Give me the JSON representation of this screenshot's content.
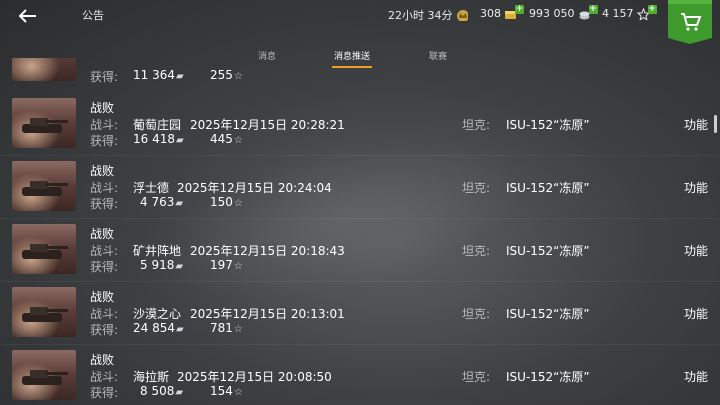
{
  "header": {
    "title": "公告",
    "timer": "22小时 34分",
    "gold": "308",
    "credits": "993 050",
    "free_xp": "4 157"
  },
  "tabs": [
    {
      "label": "消息",
      "active": false
    },
    {
      "label": "消息推送",
      "active": true
    },
    {
      "label": "联赛",
      "active": false
    }
  ],
  "partial_row": {
    "credits": "11 364",
    "xp": "255"
  },
  "labels": {
    "battle": "战斗:",
    "earned": "获得:",
    "tank": "坦克:",
    "function": "功能"
  },
  "entries": [
    {
      "result": "战败",
      "map": "葡萄庄园",
      "datetime": "2025年12月15日 20:28:21",
      "tank": "ISU-152“冻原”",
      "credits": "16 418",
      "xp": "445"
    },
    {
      "result": "战败",
      "map": "浮士德",
      "datetime": "2025年12月15日 20:24:04",
      "tank": "ISU-152“冻原”",
      "credits": "4 763",
      "xp": "150"
    },
    {
      "result": "战败",
      "map": "矿井阵地",
      "datetime": "2025年12月15日 20:18:43",
      "tank": "ISU-152“冻原”",
      "credits": "5 918",
      "xp": "197"
    },
    {
      "result": "战败",
      "map": "沙漠之心",
      "datetime": "2025年12月15日 20:13:01",
      "tank": "ISU-152“冻原”",
      "credits": "24 854",
      "xp": "781"
    },
    {
      "result": "战败",
      "map": "海拉斯",
      "datetime": "2025年12月15日 20:08:50",
      "tank": "ISU-152“冻原”",
      "credits": "8 508",
      "xp": "154"
    }
  ],
  "colors": {
    "accent": "#f39b2a",
    "shop": "#3f9a2d",
    "plus": "#4fae2e"
  },
  "icons": [
    "back-arrow-icon",
    "gold-icon",
    "credits-icon",
    "free-xp-icon",
    "shop-cart-icon",
    "silver-icon",
    "star-icon",
    "tank-icon"
  ]
}
